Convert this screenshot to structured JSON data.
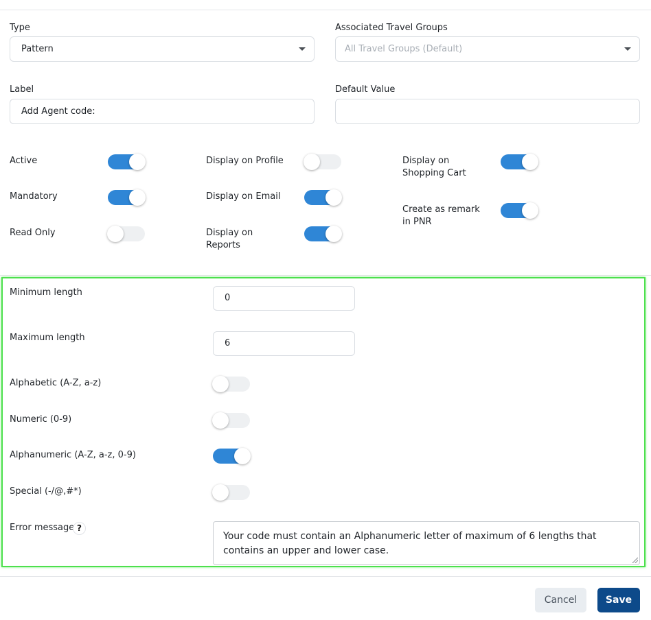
{
  "form": {
    "type": {
      "label": "Type",
      "value": "Pattern"
    },
    "travel_groups": {
      "label": "Associated Travel Groups",
      "value": "All Travel Groups (Default)"
    },
    "label_field": {
      "label": "Label",
      "value": "Add Agent code:"
    },
    "default_value": {
      "label": "Default Value",
      "value": ""
    }
  },
  "toggles": {
    "active": {
      "label": "Active",
      "on": true
    },
    "mandatory": {
      "label": "Mandatory",
      "on": true
    },
    "read_only": {
      "label": "Read Only",
      "on": false
    },
    "display_profile": {
      "label": "Display on Profile",
      "on": false
    },
    "display_email": {
      "label": "Display on Email",
      "on": true
    },
    "display_reports": {
      "label_line1": "Display on",
      "label_line2": "Reports",
      "on": true
    },
    "display_cart": {
      "label_line1": "Display on",
      "label_line2": "Shopping Cart",
      "on": true
    },
    "remark_pnr": {
      "label_line1": "Create as remark",
      "label_line2": "in PNR",
      "on": true
    }
  },
  "pattern": {
    "min_length": {
      "label": "Minimum length",
      "value": "0"
    },
    "max_length": {
      "label": "Maximum length",
      "value": "6"
    },
    "alphabetic": {
      "label": "Alphabetic (A-Z, a-z)",
      "on": false
    },
    "numeric": {
      "label": "Numeric (0-9)",
      "on": false
    },
    "alphanumeric": {
      "label": "Alphanumeric (A-Z, a-z, 0-9)",
      "on": true
    },
    "special": {
      "label": "Special (-/@,#*)",
      "on": false
    },
    "error_message": {
      "label": "Error message",
      "help_glyph": "?",
      "value": "Your code must contain an Alphanumeric letter of maximum of 6 lengths that contains an upper and lower case."
    }
  },
  "footer": {
    "cancel_label": "Cancel",
    "save_label": "Save"
  },
  "colors": {
    "toggle_on": "#2f86d6",
    "save_button": "#0d4a8a",
    "highlight_border": "#4de04d"
  }
}
